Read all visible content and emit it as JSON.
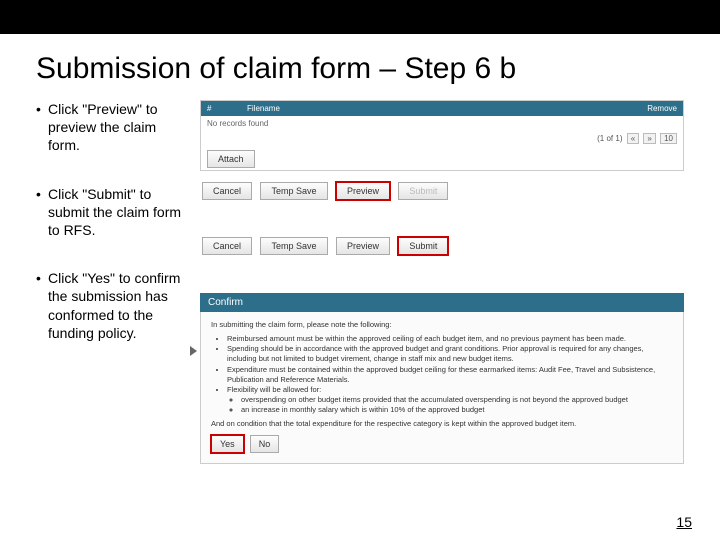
{
  "title": "Submission of claim form – Step 6 b",
  "bullets": [
    "Click \"Preview\" to preview the claim form.",
    "Click \"Submit\" to submit the claim form to RFS.",
    "Click \"Yes\" to confirm the submission  has conformed to the funding policy."
  ],
  "panel1": {
    "cols": {
      "c1": "#",
      "c2": "Filename",
      "c3": "Remove"
    },
    "empty_text": "No records found",
    "pager": {
      "range": "(1 of 1)",
      "prev": "«",
      "next": "»",
      "size": "10"
    },
    "attach": "Attach",
    "buttons": {
      "cancel": "Cancel",
      "tempsave": "Temp Save",
      "preview": "Preview",
      "submit": "Submit"
    }
  },
  "panel2": {
    "buttons": {
      "cancel": "Cancel",
      "tempsave": "Temp Save",
      "preview": "Preview",
      "submit": "Submit"
    }
  },
  "confirm": {
    "head": "Confirm",
    "lead": "In submitting the claim form, please note the following:",
    "items": [
      "Reimbursed amount must be within the approved ceiling of each budget item, and no previous payment has been made.",
      "Spending should be in accordance with the approved budget and grant conditions. Prior approval is required for any changes, including but not limited to budget virement, change in staff mix and new budget items.",
      "Expenditure must be contained within the approved budget ceiling for these earmarked items: Audit Fee, Travel and Subsistence, Publication and Reference Materials.",
      "Flexibility will be allowed for:"
    ],
    "subitems": [
      "overspending on other budget items provided that the accumulated overspending is not beyond the approved budget",
      "an increase in monthly salary which is within 10% of the approved budget"
    ],
    "tail": "And on condition that the total expenditure for the respective category is kept within the approved budget item.",
    "yes": "Yes",
    "no": "No"
  },
  "page_number": "15"
}
